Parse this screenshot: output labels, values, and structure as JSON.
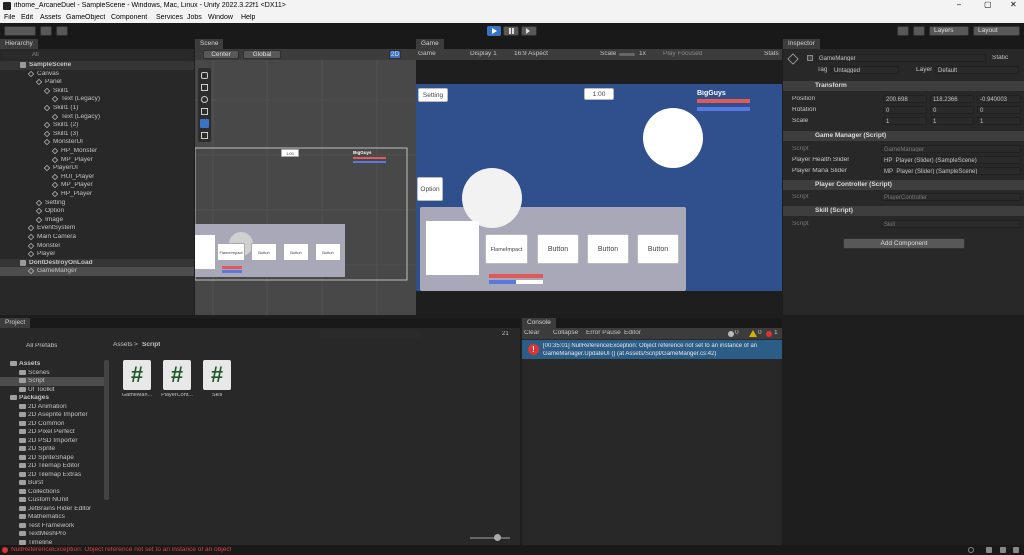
{
  "window": {
    "title": "ithome_ArcaneDuel - SampleScene - Windows, Mac, Linux - Unity 2022.3.22f1 <DX11>",
    "controls": [
      "–",
      "▢",
      "✕"
    ]
  },
  "menu": [
    "File",
    "Edit",
    "Assets",
    "GameObject",
    "Component",
    "Services",
    "Jobs",
    "Window",
    "Help"
  ],
  "toolbar": {
    "play_icon": "play-icon",
    "pause_icon": "pause-icon",
    "step_icon": "step-icon",
    "layers_label": "Layers",
    "layout_label": "Layout"
  },
  "hierarchy": {
    "tab": "Hierarchy",
    "search_placeholder": "All",
    "items": [
      {
        "label": "SampleScene",
        "depth": 0,
        "type": "scene"
      },
      {
        "label": "Canvas",
        "depth": 1,
        "type": "obj"
      },
      {
        "label": "Panel",
        "depth": 2,
        "type": "obj"
      },
      {
        "label": "Skill1",
        "depth": 3,
        "type": "obj"
      },
      {
        "label": "Text (Legacy)",
        "depth": 4,
        "type": "obj"
      },
      {
        "label": "Skill1 (1)",
        "depth": 3,
        "type": "obj"
      },
      {
        "label": "Text (Legacy)",
        "depth": 4,
        "type": "obj"
      },
      {
        "label": "Skill1 (2)",
        "depth": 3,
        "type": "obj"
      },
      {
        "label": "Skill1 (3)",
        "depth": 3,
        "type": "obj"
      },
      {
        "label": "MonsterUI",
        "depth": 3,
        "type": "obj"
      },
      {
        "label": "HP_Monster",
        "depth": 4,
        "type": "obj"
      },
      {
        "label": "MP_Player",
        "depth": 4,
        "type": "obj"
      },
      {
        "label": "PlayerUI",
        "depth": 3,
        "type": "obj"
      },
      {
        "label": "HUI_Player",
        "depth": 4,
        "type": "obj"
      },
      {
        "label": "MP_Player",
        "depth": 4,
        "type": "obj"
      },
      {
        "label": "HP_Player",
        "depth": 4,
        "type": "obj"
      },
      {
        "label": "Setting",
        "depth": 2,
        "type": "obj"
      },
      {
        "label": "Option",
        "depth": 2,
        "type": "obj"
      },
      {
        "label": "Image",
        "depth": 2,
        "type": "obj"
      },
      {
        "label": "EventSystem",
        "depth": 1,
        "type": "obj"
      },
      {
        "label": "Main Camera",
        "depth": 1,
        "type": "obj"
      },
      {
        "label": "Monster",
        "depth": 1,
        "type": "obj"
      },
      {
        "label": "Player",
        "depth": 1,
        "type": "obj"
      },
      {
        "label": "DontDestroyOnLoad",
        "depth": 0,
        "type": "scene"
      },
      {
        "label": "GameManger",
        "depth": 1,
        "type": "obj"
      }
    ]
  },
  "scene": {
    "tab": "Scene",
    "pivot": "Center",
    "space": "Global",
    "mode_2d": "2D",
    "canvas_timer": "1:00",
    "canvas_bigguys": "BigGuys",
    "canvas_buttons": [
      "FlameImpact",
      "Button",
      "Button",
      "Button"
    ]
  },
  "game": {
    "tab": "Game",
    "display_mode": "Game",
    "display": "Display 1",
    "aspect": "16:9 Aspect",
    "scale_label": "Scale",
    "scale_value": "1x",
    "play_focused": "Play Focused",
    "stats": "Stats",
    "setting_btn": "Setting",
    "option_btn": "Option",
    "timer": "1:00",
    "bigguys": "BigGuys",
    "buttons": [
      "FlameImpact",
      "Button",
      "Button",
      "Button"
    ],
    "colors": {
      "bg": "#2f4f8d",
      "hp": "#e05a5a",
      "mp": "#5a79e0"
    }
  },
  "inspector": {
    "tab": "Inspector",
    "object_name": "GameManger",
    "static_label": "Static",
    "tag_label": "Tag",
    "tag_value": "Untagged",
    "layer_label": "Layer",
    "layer_value": "Default",
    "transform": {
      "title": "Transform",
      "position_label": "Position",
      "rotation_label": "Rotation",
      "scale_label": "Scale",
      "position": [
        "200.698",
        "118.2366",
        "-0.940003"
      ],
      "rotation": [
        "0",
        "0",
        "0"
      ],
      "scale": [
        "1",
        "1",
        "1"
      ]
    },
    "game_manager": {
      "title": "Game Manager (Script)",
      "script_label": "Script",
      "script_value": "GameManager",
      "health_label": "Player Health Slider",
      "health_value": "HP_Player (Slider) (SampleScene)",
      "mana_label": "Player Mana Slider",
      "mana_value": "MP_Player (Slider) (SampleScene)"
    },
    "player_controller": {
      "title": "Player Controller (Script)",
      "script_label": "Script",
      "script_value": "PlayerController"
    },
    "skill": {
      "title": "Skill (Script)",
      "script_label": "Script",
      "script_value": "Skill"
    },
    "add_component": "Add Component"
  },
  "project": {
    "tab": "Project",
    "all_prefabs": "All Prefabs",
    "breadcrumb_root": "Assets",
    "breadcrumb_sep": ">",
    "breadcrumb_leaf": "Script",
    "tree": [
      {
        "label": "Assets",
        "depth": 0,
        "bold": true
      },
      {
        "label": "Scenes",
        "depth": 1
      },
      {
        "label": "Script",
        "depth": 1,
        "selected": true
      },
      {
        "label": "UI Toolkit",
        "depth": 1
      },
      {
        "label": "Packages",
        "depth": 0,
        "bold": true
      },
      {
        "label": "2D Animation",
        "depth": 1
      },
      {
        "label": "2D Aseprite Importer",
        "depth": 1
      },
      {
        "label": "2D Common",
        "depth": 1
      },
      {
        "label": "2D Pixel Perfect",
        "depth": 1
      },
      {
        "label": "2D PSD Importer",
        "depth": 1
      },
      {
        "label": "2D Sprite",
        "depth": 1
      },
      {
        "label": "2D SpriteShape",
        "depth": 1
      },
      {
        "label": "2D Tilemap Editor",
        "depth": 1
      },
      {
        "label": "2D Tilemap Extras",
        "depth": 1
      },
      {
        "label": "Burst",
        "depth": 1
      },
      {
        "label": "Collections",
        "depth": 1
      },
      {
        "label": "Custom NUnit",
        "depth": 1
      },
      {
        "label": "JetBrains Rider Editor",
        "depth": 1
      },
      {
        "label": "Mathematics",
        "depth": 1
      },
      {
        "label": "Test Framework",
        "depth": 1
      },
      {
        "label": "TextMeshPro",
        "depth": 1
      },
      {
        "label": "Timeline",
        "depth": 1
      }
    ],
    "files": [
      "GameMan...",
      "PlayerCont...",
      "Skill"
    ],
    "count": "21"
  },
  "console": {
    "tab": "Console",
    "clear": "Clear",
    "collapse": "Collapse",
    "error_pause": "Error Pause",
    "editor": "Editor",
    "warn_count": "0",
    "log_count": "0",
    "err_count": "1",
    "message_line1": "[00:35:01] NullReferenceException: Object reference not set to an instance of an",
    "message_line2": "GameManager.UpdateUI () (at Assets/Script/GameManger.cs:42)"
  },
  "status": {
    "message": "NullReferenceException: Object reference not set to an instance of an object"
  }
}
